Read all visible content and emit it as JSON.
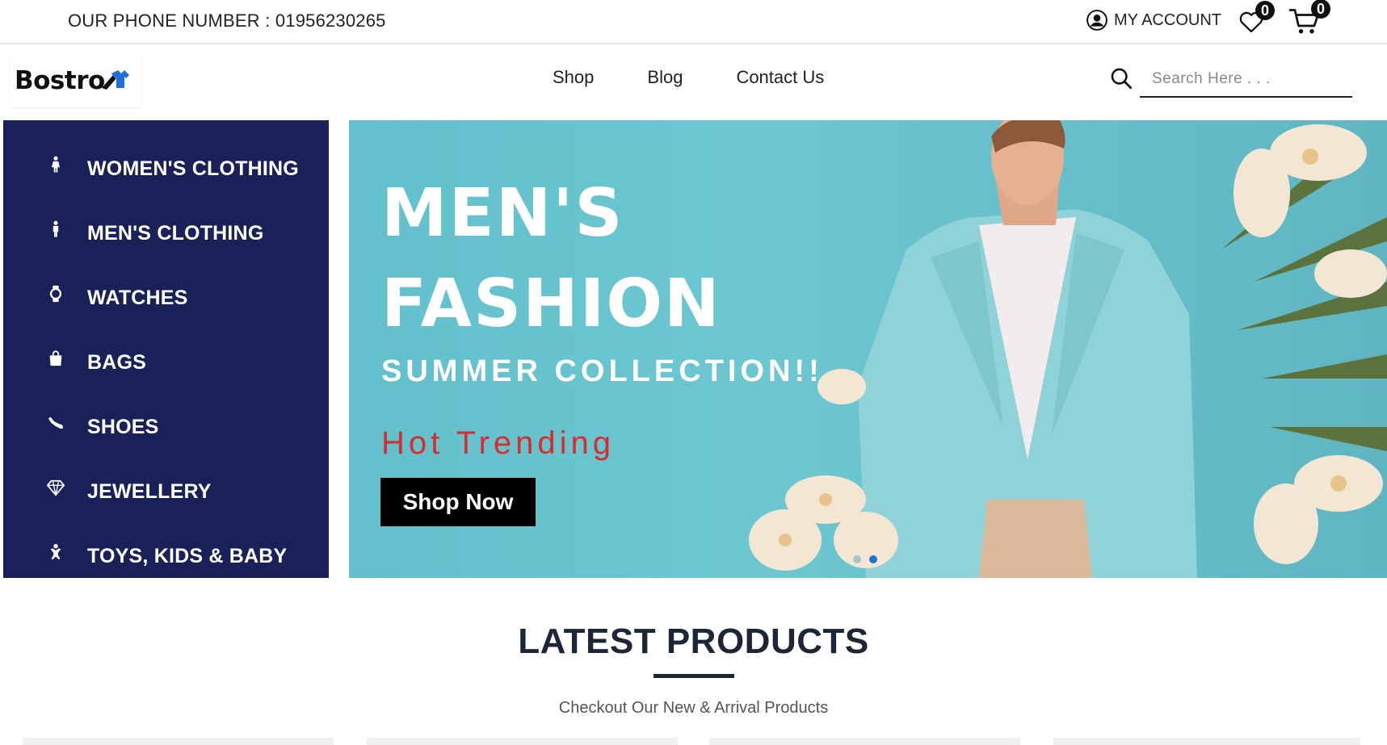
{
  "topbar": {
    "phone": "OUR PHONE NUMBER : 01956230265",
    "account_label": "MY ACCOUNT",
    "wishlist_count": "0",
    "cart_count": "0"
  },
  "header": {
    "logo_text": "Bostro",
    "nav": [
      "Shop",
      "Blog",
      "Contact Us"
    ],
    "search_placeholder": "Search Here . . ."
  },
  "sidebar": {
    "items": [
      {
        "label": "WOMEN'S CLOTHING",
        "icon": "female-icon"
      },
      {
        "label": "MEN'S CLOTHING",
        "icon": "male-icon"
      },
      {
        "label": "WATCHES",
        "icon": "watch-icon"
      },
      {
        "label": "BAGS",
        "icon": "bag-icon"
      },
      {
        "label": "SHOES",
        "icon": "shoe-icon"
      },
      {
        "label": "JEWELLERY",
        "icon": "diamond-icon"
      },
      {
        "label": "TOYS, KIDS & BABY",
        "icon": "baby-icon"
      }
    ]
  },
  "hero": {
    "title_line1": "MEN'S",
    "title_line2": "FASHION",
    "subtitle": "SUMMER COLLECTION!!",
    "trend": "Hot Trending",
    "button": "Shop Now",
    "active_slide": 2
  },
  "latest": {
    "title": "LATEST PRODUCTS",
    "subtitle": "Checkout Our New & Arrival Products"
  },
  "colors": {
    "sidebar_bg": "#1a2158",
    "hero_bg": "#62c0cc",
    "trend_red": "#d32f2f",
    "dot_active": "#1976d2"
  }
}
